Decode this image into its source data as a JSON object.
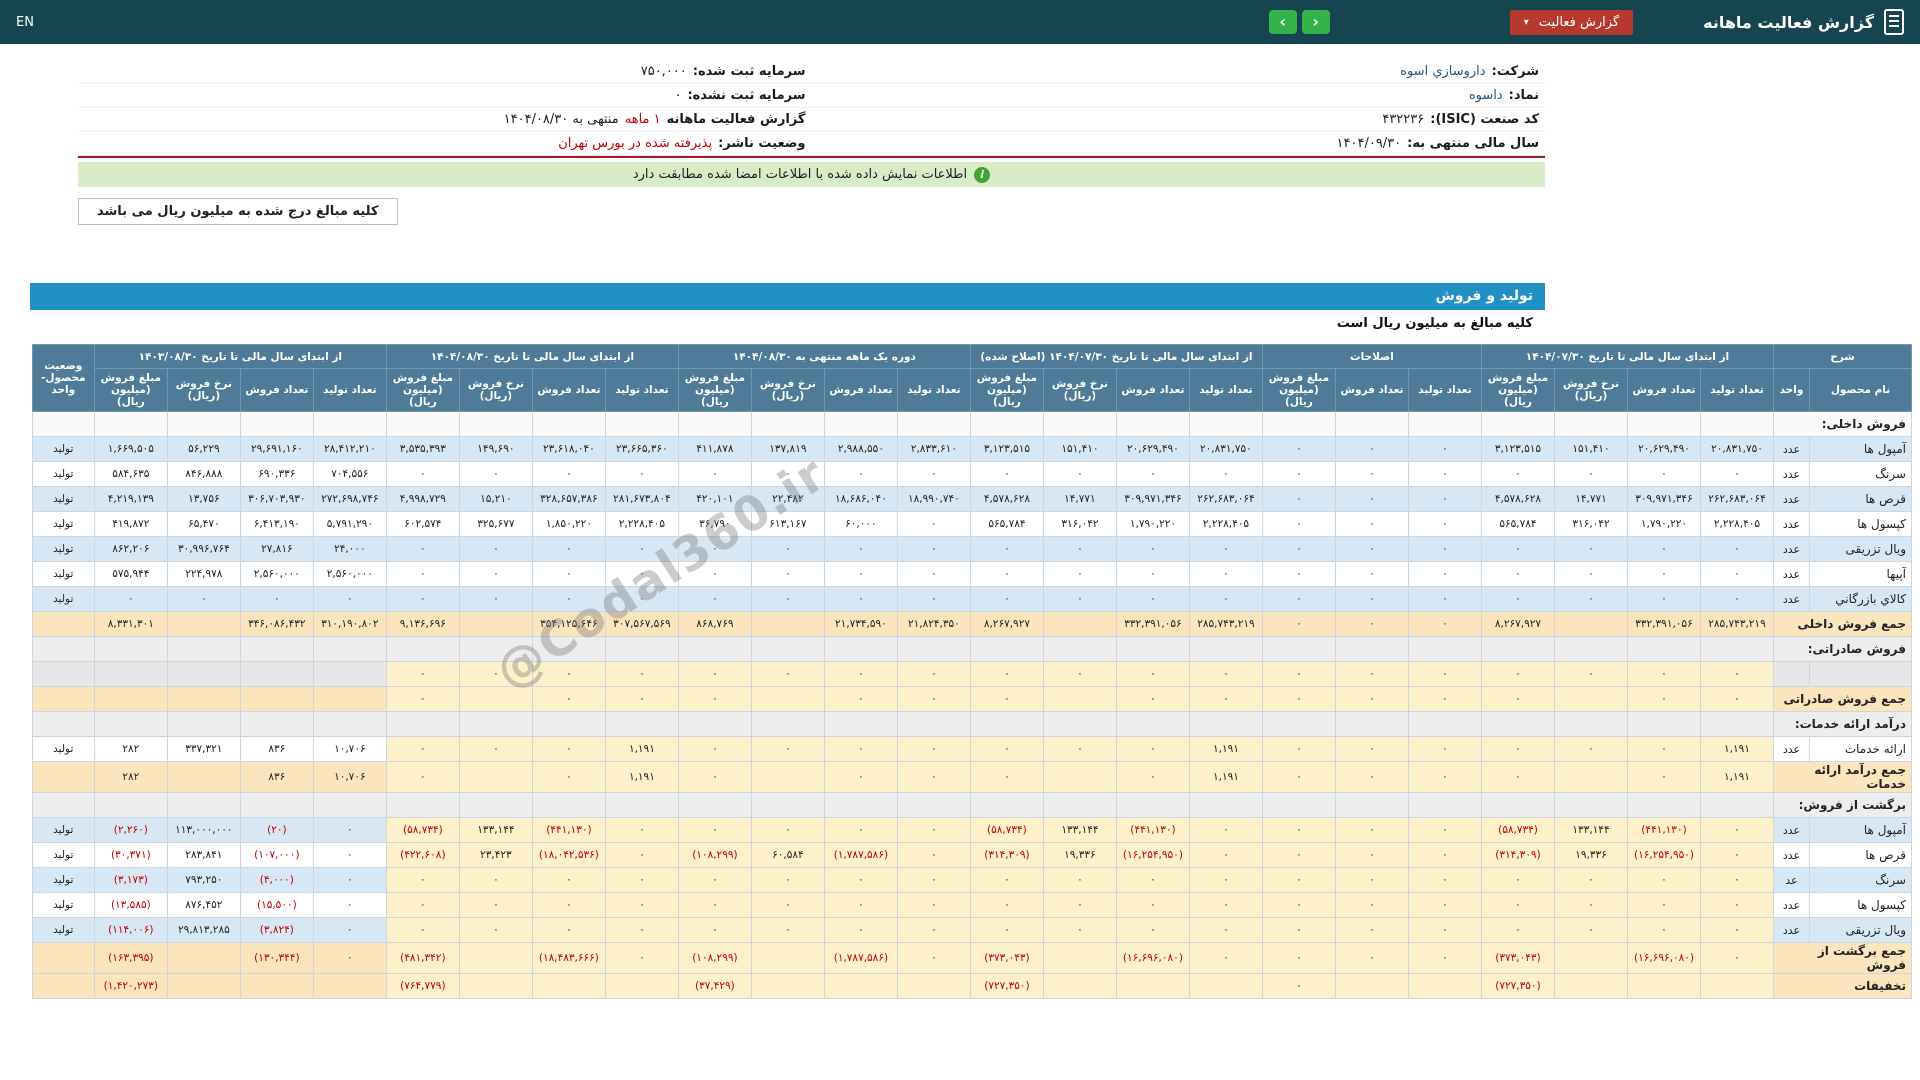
{
  "navbar": {
    "title": "گزارش فعالیت ماهانه",
    "dropdown": "گزارش فعالیت",
    "prev": "‹",
    "next": "›",
    "lang": "EN"
  },
  "company": {
    "col_right": [
      {
        "label": "شرکت:",
        "value": "داروسازي اسوه"
      },
      {
        "label": "نماد:",
        "value": "داسوه"
      },
      {
        "label": "کد صنعت (ISIC):",
        "value": "۴۳۲۲۳۶"
      },
      {
        "label": "سال مالی منتهی به:",
        "value": "۱۴۰۴/۰۹/۳۰"
      }
    ],
    "col_left": [
      {
        "label": "سرمایه ثبت شده:",
        "value": "۷۵۰,۰۰۰"
      },
      {
        "label": "سرمایه ثبت نشده:",
        "value": "۰"
      },
      {
        "label": "گزارش فعالیت ماهانه",
        "value_red": "۱ ماهه",
        "value_tail": "منتهی به ۱۴۰۴/۰۸/۳۰"
      },
      {
        "label": "وضعیت ناشر:",
        "value_red": "پذیرفته شده در بورس تهران"
      }
    ]
  },
  "banner": {
    "text": "اطلاعات نمایش داده شده با اطلاعات امضا شده مطابقت دارد"
  },
  "tab": {
    "label": "کلیه مبالغ درج شده به میلیون ریال می باشد"
  },
  "section": {
    "title": "تولید و فروش",
    "note": "کلیه مبالغ به میلیون ریال است"
  },
  "watermark": "@Codal360.ir",
  "table": {
    "col_groups": [
      {
        "title": "شرح",
        "cols": [
          "نام محصول",
          "واحد"
        ]
      },
      {
        "title": "از ابتدای سال مالی تا تاریخ ۱۴۰۴/۰۷/۳۰",
        "cols": [
          "تعداد تولید",
          "تعداد فروش",
          "نرخ فروش (ریال)",
          "مبلغ فروش (میلیون ریال)"
        ]
      },
      {
        "title": "اصلاحات",
        "cols": [
          "تعداد تولید",
          "تعداد فروش",
          "مبلغ فروش (میلیون ریال)"
        ]
      },
      {
        "title": "از ابتدای سال مالی تا تاریخ ۱۴۰۴/۰۷/۳۰ (اصلاح شده)",
        "cols": [
          "تعداد تولید",
          "تعداد فروش",
          "نرخ فروش (ریال)",
          "مبلغ فروش (میلیون ریال)"
        ]
      },
      {
        "title": "دوره یک ماهه منتهی به ۱۴۰۴/۰۸/۳۰",
        "cols": [
          "تعداد تولید",
          "تعداد فروش",
          "نرخ فروش (ریال)",
          "مبلغ فروش (میلیون ریال)"
        ]
      },
      {
        "title": "از ابتدای سال مالی تا تاریخ ۱۴۰۴/۰۸/۳۰",
        "cols": [
          "تعداد تولید",
          "تعداد فروش",
          "نرخ فروش (ریال)",
          "مبلغ فروش (میلیون ریال)"
        ]
      },
      {
        "title": "از ابتدای سال مالی تا تاریخ ۱۴۰۳/۰۸/۳۰",
        "cols": [
          "تعداد تولید",
          "تعداد فروش",
          "نرخ فروش (ریال)",
          "مبلغ فروش (میلیون ریال)"
        ]
      },
      {
        "title": "وضعیت محصول-واحد",
        "cols": []
      }
    ],
    "rows": [
      {
        "type": "section",
        "shade": "white",
        "name": "فروش داخلی:"
      },
      {
        "type": "product",
        "shade": "blue",
        "name": "آمپول ها",
        "unit": "عدد",
        "status": "تولید",
        "cells": [
          "۲۰,۸۳۱,۷۵۰",
          "۲۰,۶۲۹,۴۹۰",
          "۱۵۱,۴۱۰",
          "۳,۱۲۳,۵۱۵",
          "۰",
          "۰",
          "۰",
          "۲۰,۸۳۱,۷۵۰",
          "۲۰,۶۲۹,۴۹۰",
          "۱۵۱,۴۱۰",
          "۳,۱۲۳,۵۱۵",
          "۲,۸۳۳,۶۱۰",
          "۲,۹۸۸,۵۵۰",
          "۱۳۷,۸۱۹",
          "۴۱۱,۸۷۸",
          "۲۳,۶۶۵,۳۶۰",
          "۲۳,۶۱۸,۰۴۰",
          "۱۴۹,۶۹۰",
          "۳,۵۳۵,۳۹۳",
          "۲۸,۴۱۲,۲۱۰",
          "۲۹,۶۹۱,۱۶۰",
          "۵۶,۲۲۹",
          "۱,۶۶۹,۵۰۵"
        ]
      },
      {
        "type": "product",
        "shade": "white",
        "name": "سرنگ",
        "unit": "عدد",
        "status": "تولید",
        "cells": [
          "۰",
          "۰",
          "۰",
          "۰",
          "۰",
          "۰",
          "۰",
          "۰",
          "۰",
          "۰",
          "۰",
          "۰",
          "۰",
          "۰",
          "۰",
          "۰",
          "۰",
          "۰",
          "۰",
          "۷۰۴,۵۵۶",
          "۶۹۰,۳۳۶",
          "۸۴۶,۸۸۸",
          "۵۸۴,۶۳۵"
        ]
      },
      {
        "type": "product",
        "shade": "blue",
        "name": "قرص ها",
        "unit": "عدد",
        "status": "تولید",
        "cells": [
          "۲۶۲,۶۸۳,۰۶۴",
          "۳۰۹,۹۷۱,۳۴۶",
          "۱۴,۷۷۱",
          "۴,۵۷۸,۶۲۸",
          "۰",
          "۰",
          "۰",
          "۲۶۲,۶۸۳,۰۶۴",
          "۳۰۹,۹۷۱,۳۴۶",
          "۱۴,۷۷۱",
          "۴,۵۷۸,۶۲۸",
          "۱۸,۹۹۰,۷۴۰",
          "۱۸,۶۸۶,۰۴۰",
          "۲۲,۴۸۲",
          "۴۲۰,۱۰۱",
          "۲۸۱,۶۷۳,۸۰۴",
          "۳۲۸,۶۵۷,۳۸۶",
          "۱۵,۲۱۰",
          "۴,۹۹۸,۷۲۹",
          "۲۷۲,۶۹۸,۷۴۶",
          "۳۰۶,۷۰۳,۹۳۰",
          "۱۳,۷۵۶",
          "۴,۲۱۹,۱۳۹"
        ]
      },
      {
        "type": "product",
        "shade": "white",
        "name": "کپسول ها",
        "unit": "عدد",
        "status": "تولید",
        "cells": [
          "۲,۲۲۸,۴۰۵",
          "۱,۷۹۰,۲۲۰",
          "۳۱۶,۰۴۲",
          "۵۶۵,۷۸۴",
          "۰",
          "۰",
          "۰",
          "۲,۲۲۸,۴۰۵",
          "۱,۷۹۰,۲۲۰",
          "۳۱۶,۰۴۲",
          "۵۶۵,۷۸۴",
          "۰",
          "۶۰,۰۰۰",
          "۶۱۳,۱۶۷",
          "۳۶,۷۹۰",
          "۲,۲۲۸,۴۰۵",
          "۱,۸۵۰,۲۲۰",
          "۳۲۵,۶۷۷",
          "۶۰۲,۵۷۴",
          "۵,۷۹۱,۲۹۰",
          "۶,۴۱۳,۱۹۰",
          "۶۵,۴۷۰",
          "۴۱۹,۸۷۲"
        ]
      },
      {
        "type": "product",
        "shade": "blue",
        "name": "ویال تزریقی",
        "unit": "عدد",
        "status": "تولید",
        "cells": [
          "۰",
          "۰",
          "۰",
          "۰",
          "۰",
          "۰",
          "۰",
          "۰",
          "۰",
          "۰",
          "۰",
          "۰",
          "۰",
          "۰",
          "۰",
          "۰",
          "۰",
          "۰",
          "۰",
          "۲۴,۰۰۰",
          "۲۷,۸۱۶",
          "۳۰,۹۹۶,۷۶۴",
          "۸۶۲,۲۰۶"
        ]
      },
      {
        "type": "product",
        "shade": "white",
        "name": "آپیها",
        "unit": "عدد",
        "status": "تولید",
        "cells": [
          "۰",
          "۰",
          "۰",
          "۰",
          "۰",
          "۰",
          "۰",
          "۰",
          "۰",
          "۰",
          "۰",
          "۰",
          "۰",
          "۰",
          "۰",
          "۰",
          "۰",
          "۰",
          "۰",
          "۲,۵۶۰,۰۰۰",
          "۲,۵۶۰,۰۰۰",
          "۲۲۴,۹۷۸",
          "۵۷۵,۹۴۴"
        ]
      },
      {
        "type": "product",
        "shade": "blue",
        "name": "کالاي بازرگاني",
        "unit": "عدد",
        "status": "تولید",
        "cells": [
          "۰",
          "۰",
          "۰",
          "۰",
          "۰",
          "۰",
          "۰",
          "۰",
          "۰",
          "۰",
          "۰",
          "۰",
          "۰",
          "۰",
          "۰",
          "۰",
          "۰",
          "۰",
          "۰",
          "۰",
          "۰",
          "۰",
          "۰"
        ]
      },
      {
        "type": "sum",
        "name": "جمع فروش داخلی",
        "cells": [
          "۲۸۵,۷۴۳,۲۱۹",
          "۳۳۲,۳۹۱,۰۵۶",
          "",
          "۸,۲۶۷,۹۲۷",
          "۰",
          "۰",
          "۰",
          "۲۸۵,۷۴۳,۲۱۹",
          "۳۳۲,۳۹۱,۰۵۶",
          "",
          "۸,۲۶۷,۹۲۷",
          "۲۱,۸۲۴,۳۵۰",
          "۲۱,۷۳۴,۵۹۰",
          "",
          "۸۶۸,۷۶۹",
          "۳۰۷,۵۶۷,۵۶۹",
          "۳۵۴,۱۲۵,۶۴۶",
          "",
          "۹,۱۳۶,۶۹۶",
          "۳۱۰,۱۹۰,۸۰۲",
          "۳۴۶,۰۸۶,۴۳۲",
          "",
          "۸,۳۳۱,۳۰۱"
        ]
      },
      {
        "type": "section",
        "shade": "gray",
        "name": "فروش صادراتی:"
      },
      {
        "type": "product",
        "shade": "gray",
        "hl": true,
        "name": "",
        "unit": "",
        "status": "",
        "cells": [
          "۰",
          "۰",
          "۰",
          "۰",
          "۰",
          "۰",
          "۰",
          "۰",
          "۰",
          "۰",
          "۰",
          "۰",
          "۰",
          "۰",
          "۰",
          "۰",
          "۰",
          "۰",
          "۰",
          "",
          "",
          "",
          ""
        ]
      },
      {
        "type": "sum",
        "hl": true,
        "name": "جمع فروش صادراتی",
        "cells": [
          "۰",
          "۰",
          "",
          "۰",
          "۰",
          "۰",
          "۰",
          "۰",
          "۰",
          "",
          "۰",
          "۰",
          "۰",
          "",
          "۰",
          "۰",
          "۰",
          "",
          "۰",
          "",
          "",
          "",
          ""
        ]
      },
      {
        "type": "section",
        "shade": "gray",
        "name": "درآمد ارائه خدمات:"
      },
      {
        "type": "product",
        "shade": "white",
        "hl": true,
        "name": "ارائه خدمات",
        "unit": "عدد",
        "status": "تولید",
        "cells": [
          "۱,۱۹۱",
          "۰",
          "۰",
          "۰",
          "۰",
          "۰",
          "۰",
          "۱,۱۹۱",
          "۰",
          "۰",
          "۰",
          "۰",
          "۰",
          "۰",
          "۰",
          "۱,۱۹۱",
          "۰",
          "۰",
          "۰",
          "۱۰,۷۰۶",
          "۸۳۶",
          "۳۳۷,۳۲۱",
          "۲۸۲"
        ]
      },
      {
        "type": "sum",
        "hl": true,
        "name": "جمع درآمد ارائه خدمات",
        "cells": [
          "۱,۱۹۱",
          "۰",
          "",
          "۰",
          "۰",
          "۰",
          "۰",
          "۱,۱۹۱",
          "۰",
          "",
          "۰",
          "۰",
          "۰",
          "",
          "۰",
          "۱,۱۹۱",
          "۰",
          "",
          "۰",
          "۱۰,۷۰۶",
          "۸۳۶",
          "",
          "۲۸۲"
        ]
      },
      {
        "type": "section",
        "shade": "gray",
        "name": "برگشت از فروش:"
      },
      {
        "type": "product",
        "shade": "blue",
        "hl": true,
        "name": "آمپول ها",
        "unit": "عدد",
        "status": "تولید",
        "cells": [
          "۰",
          "(۴۴۱,۱۳۰)",
          "۱۳۳,۱۴۴",
          "(۵۸,۷۳۴)",
          "۰",
          "۰",
          "۰",
          "۰",
          "(۴۴۱,۱۳۰)",
          "۱۳۳,۱۴۴",
          "(۵۸,۷۳۴)",
          "۰",
          "۰",
          "۰",
          "۰",
          "۰",
          "(۴۴۱,۱۳۰)",
          "۱۳۳,۱۴۴",
          "(۵۸,۷۳۴)",
          "۰",
          "(۲۰)",
          "۱۱۳,۰۰۰,۰۰۰",
          "(۲,۲۶۰)"
        ]
      },
      {
        "type": "product",
        "shade": "white",
        "hl": true,
        "name": "قرص ها",
        "unit": "عدد",
        "status": "تولید",
        "cells": [
          "۰",
          "(۱۶,۲۵۴,۹۵۰)",
          "۱۹,۳۳۶",
          "(۳۱۴,۳۰۹)",
          "۰",
          "۰",
          "۰",
          "۰",
          "(۱۶,۲۵۴,۹۵۰)",
          "۱۹,۳۳۶",
          "(۳۱۴,۳۰۹)",
          "۰",
          "(۱,۷۸۷,۵۸۶)",
          "۶۰,۵۸۴",
          "(۱۰۸,۲۹۹)",
          "۰",
          "(۱۸,۰۴۲,۵۳۶)",
          "۲۳,۴۲۳",
          "(۴۲۲,۶۰۸)",
          "۰",
          "(۱۰۷,۰۰۰)",
          "۲۸۳,۸۴۱",
          "(۳۰,۳۷۱)"
        ]
      },
      {
        "type": "product",
        "shade": "blue",
        "hl": true,
        "name": "سرنگ",
        "unit": "عد",
        "status": "تولید",
        "cells": [
          "۰",
          "۰",
          "۰",
          "۰",
          "۰",
          "۰",
          "۰",
          "۰",
          "۰",
          "۰",
          "۰",
          "۰",
          "۰",
          "۰",
          "۰",
          "۰",
          "۰",
          "۰",
          "۰",
          "۰",
          "(۴,۰۰۰)",
          "۷۹۳,۲۵۰",
          "(۳,۱۷۳)"
        ]
      },
      {
        "type": "product",
        "shade": "white",
        "hl": true,
        "name": "کپسول ها",
        "unit": "عدد",
        "status": "تولید",
        "cells": [
          "۰",
          "۰",
          "۰",
          "۰",
          "۰",
          "۰",
          "۰",
          "۰",
          "۰",
          "۰",
          "۰",
          "۰",
          "۰",
          "۰",
          "۰",
          "۰",
          "۰",
          "۰",
          "۰",
          "۰",
          "(۱۵,۵۰۰)",
          "۸۷۶,۴۵۲",
          "(۱۳,۵۸۵)"
        ]
      },
      {
        "type": "product",
        "shade": "blue",
        "hl": true,
        "name": "ویال تزریقی",
        "unit": "عدد",
        "status": "تولید",
        "cells": [
          "۰",
          "۰",
          "۰",
          "۰",
          "۰",
          "۰",
          "۰",
          "۰",
          "۰",
          "۰",
          "۰",
          "۰",
          "۰",
          "۰",
          "۰",
          "۰",
          "۰",
          "۰",
          "۰",
          "۰",
          "(۳,۸۲۴)",
          "۲۹,۸۱۳,۲۸۵",
          "(۱۱۴,۰۰۶)"
        ]
      },
      {
        "type": "sum",
        "hl": true,
        "name": "جمع برگشت از فروش",
        "cells": [
          "۰",
          "(۱۶,۶۹۶,۰۸۰)",
          "",
          "(۳۷۳,۰۴۳)",
          "۰",
          "۰",
          "۰",
          "۰",
          "(۱۶,۶۹۶,۰۸۰)",
          "",
          "(۳۷۳,۰۴۳)",
          "۰",
          "(۱,۷۸۷,۵۸۶)",
          "",
          "(۱۰۸,۲۹۹)",
          "۰",
          "(۱۸,۴۸۳,۶۶۶)",
          "",
          "(۴۸۱,۳۴۲)",
          "۰",
          "(۱۳۰,۳۴۴)",
          "",
          "(۱۶۳,۳۹۵)"
        ]
      },
      {
        "type": "sum",
        "hl": true,
        "name": "تخفیفات",
        "cells": [
          "",
          "",
          "",
          "(۷۲۷,۳۵۰)",
          "",
          "",
          "۰",
          "",
          "",
          "",
          "(۷۲۷,۳۵۰)",
          "",
          "",
          "",
          "(۳۷,۴۲۹)",
          "",
          "",
          "",
          "(۷۶۴,۷۷۹)",
          "",
          "",
          "",
          "(۱,۴۲۰,۲۷۳)"
        ]
      }
    ]
  }
}
